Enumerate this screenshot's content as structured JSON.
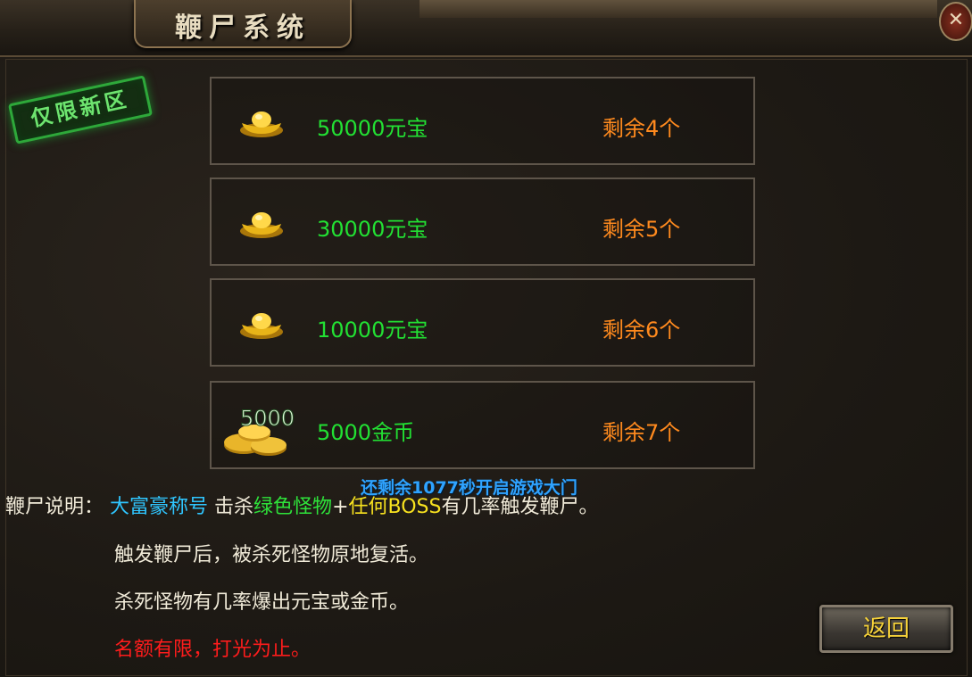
{
  "window": {
    "title": "鞭尸系统",
    "close_glyph": "✕"
  },
  "stamp": {
    "text": "仅限新区"
  },
  "rewards": [
    {
      "icon": "gold-ingot-icon",
      "name": "50000元宝",
      "remaining": "剩余4个"
    },
    {
      "icon": "gold-ingot-icon",
      "name": "30000元宝",
      "remaining": "剩余5个"
    },
    {
      "icon": "gold-ingot-icon",
      "name": "10000元宝",
      "remaining": "剩余6个"
    },
    {
      "icon": "gold-coins-icon",
      "name": "5000金币",
      "remaining": "剩余7个",
      "icon_label": "5000"
    }
  ],
  "countdown": "还剩余1077秒开启游戏大门",
  "description": {
    "label": "鞭尸说明：",
    "title_name": "大富豪称号",
    "kill_text": "击杀",
    "green_monster": "绿色怪物",
    "plus": "+",
    "any_boss": "任何BOSS",
    "tail": "有几率触发鞭尸。",
    "line2": "触发鞭尸后，被杀死怪物原地复活。",
    "line3": "杀死怪物有几率爆出元宝或金币。",
    "line4": "名额有限，打光为止。"
  },
  "buttons": {
    "back": "返回"
  },
  "colors": {
    "reward_name": "#22e033",
    "remaining": "#ff8a1e",
    "countdown": "#2fa3ff",
    "warning": "#ff1c1c"
  }
}
